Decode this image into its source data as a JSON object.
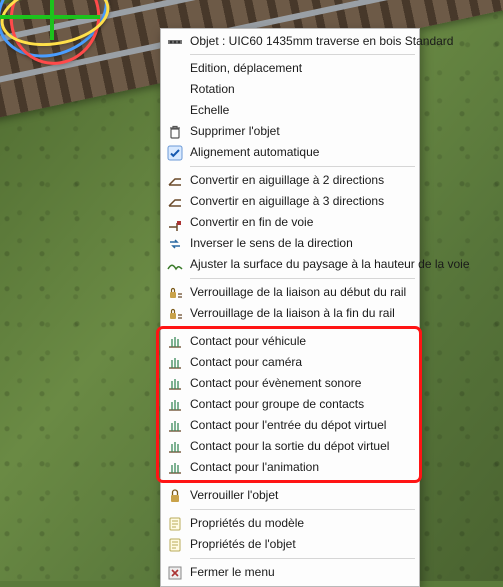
{
  "header": {
    "title": "Objet : UIC60 1435mm traverse en bois Standard"
  },
  "groups": [
    {
      "items": [
        {
          "name": "menu-edit-move",
          "icon": "none",
          "label": "Edition, déplacement"
        },
        {
          "name": "menu-rotation",
          "icon": "none",
          "label": "Rotation"
        },
        {
          "name": "menu-scale",
          "icon": "none",
          "label": "Echelle"
        },
        {
          "name": "menu-delete-object",
          "icon": "trash",
          "label": "Supprimer l'objet"
        },
        {
          "name": "menu-auto-align",
          "icon": "check",
          "label": "Alignement automatique"
        }
      ]
    },
    {
      "items": [
        {
          "name": "menu-convert-switch-2",
          "icon": "switch",
          "label": "Convertir en aiguillage à 2 directions"
        },
        {
          "name": "menu-convert-switch-3",
          "icon": "switch",
          "label": "Convertir en aiguillage à 3 directions"
        },
        {
          "name": "menu-convert-end",
          "icon": "buffer",
          "label": "Convertir en fin de voie"
        },
        {
          "name": "menu-reverse-direction",
          "icon": "reverse",
          "label": "Inverser le sens de la direction"
        },
        {
          "name": "menu-adjust-terrain",
          "icon": "terrain",
          "label": "Ajuster la surface du paysage à la hauteur de la voie"
        }
      ]
    },
    {
      "items": [
        {
          "name": "menu-lock-link-start",
          "icon": "lock-rail",
          "label": "Verrouillage de la liaison au début du rail"
        },
        {
          "name": "menu-lock-link-end",
          "icon": "lock-rail",
          "label": "Verrouillage de la liaison à la fin du rail"
        }
      ]
    },
    {
      "highlight": true,
      "items": [
        {
          "name": "menu-contact-vehicle",
          "icon": "contact",
          "label": "Contact pour véhicule"
        },
        {
          "name": "menu-contact-camera",
          "icon": "contact",
          "label": "Contact pour caméra"
        },
        {
          "name": "menu-contact-sound",
          "icon": "contact",
          "label": "Contact pour évènement sonore"
        },
        {
          "name": "menu-contact-group",
          "icon": "contact",
          "label": "Contact pour groupe de contacts"
        },
        {
          "name": "menu-contact-depot-in",
          "icon": "contact",
          "label": "Contact pour l'entrée du dépot virtuel"
        },
        {
          "name": "menu-contact-depot-out",
          "icon": "contact",
          "label": "Contact pour la sortie du dépot virtuel"
        },
        {
          "name": "menu-contact-animation",
          "icon": "contact",
          "label": "Contact pour l'animation"
        }
      ]
    },
    {
      "items": [
        {
          "name": "menu-lock-object",
          "icon": "lock",
          "label": "Verrouiller l'objet"
        }
      ]
    },
    {
      "items": [
        {
          "name": "menu-model-properties",
          "icon": "props",
          "label": "Propriétés du modèle"
        },
        {
          "name": "menu-object-properties",
          "icon": "props",
          "label": "Propriétés de l'objet"
        }
      ]
    },
    {
      "items": [
        {
          "name": "menu-close",
          "icon": "close",
          "label": "Fermer le menu"
        }
      ]
    }
  ]
}
